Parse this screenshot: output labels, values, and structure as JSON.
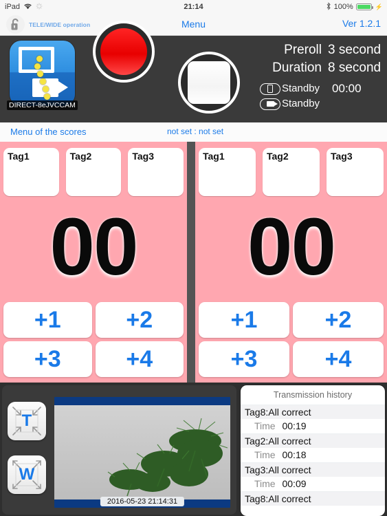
{
  "status_bar": {
    "device": "iPad",
    "wifi_icon": "wifi-icon",
    "sync_icon": "sync-spinner-icon",
    "time": "21:14",
    "bluetooth_icon": "bluetooth-icon",
    "battery_pct": "100%",
    "charging_icon": "charging-bolt-icon",
    "battery_color": "#4cd964"
  },
  "toolbar": {
    "lock_icon": "unlocked-padlock-icon",
    "lock_label": "TELE/WIDE operation",
    "menu_label": "Menu",
    "version_label": "Ver 1.2.1",
    "accent_color": "#1a7ae8"
  },
  "control_bar": {
    "app_icon_name": "jvc-cam-app-icon",
    "connection_label": "DIRECT-8eJVCCAM",
    "record_button": "record-button",
    "stop_button": "stop-button",
    "record_color": "#e80000",
    "preroll_label": "Preroll",
    "preroll_value": "3 second",
    "duration_label": "Duration",
    "duration_value": "8 second",
    "device_status_label": "Standby",
    "device_status_time": "00:00",
    "camera_status_label": "Standby"
  },
  "score_menu": {
    "menu_link": "Menu of the scores",
    "not_set": "not set : not set"
  },
  "board": {
    "background_color": "#ffa7b0",
    "divider_color": "#545454",
    "panels": [
      {
        "side": "left",
        "tags": [
          "Tag1",
          "Tag2",
          "Tag3"
        ],
        "score": "00",
        "plus_buttons": [
          "+1",
          "+2",
          "+3",
          "+4"
        ]
      },
      {
        "side": "right",
        "tags": [
          "Tag1",
          "Tag2",
          "Tag3"
        ],
        "score": "00",
        "plus_buttons": [
          "+1",
          "+2",
          "+3",
          "+4"
        ]
      }
    ]
  },
  "camera_panel": {
    "tele_button": "T",
    "wide_button": "W",
    "preview_timestamp": "2016-05-23 21:14:31"
  },
  "history": {
    "title": "Transmission history",
    "time_key": "Time",
    "items": [
      {
        "tag": "Tag8:All correct",
        "time": "00:19"
      },
      {
        "tag": "Tag2:All correct",
        "time": "00:18"
      },
      {
        "tag": "Tag3:All correct",
        "time": "00:09"
      },
      {
        "tag": "Tag8:All correct",
        "time": ""
      }
    ]
  }
}
